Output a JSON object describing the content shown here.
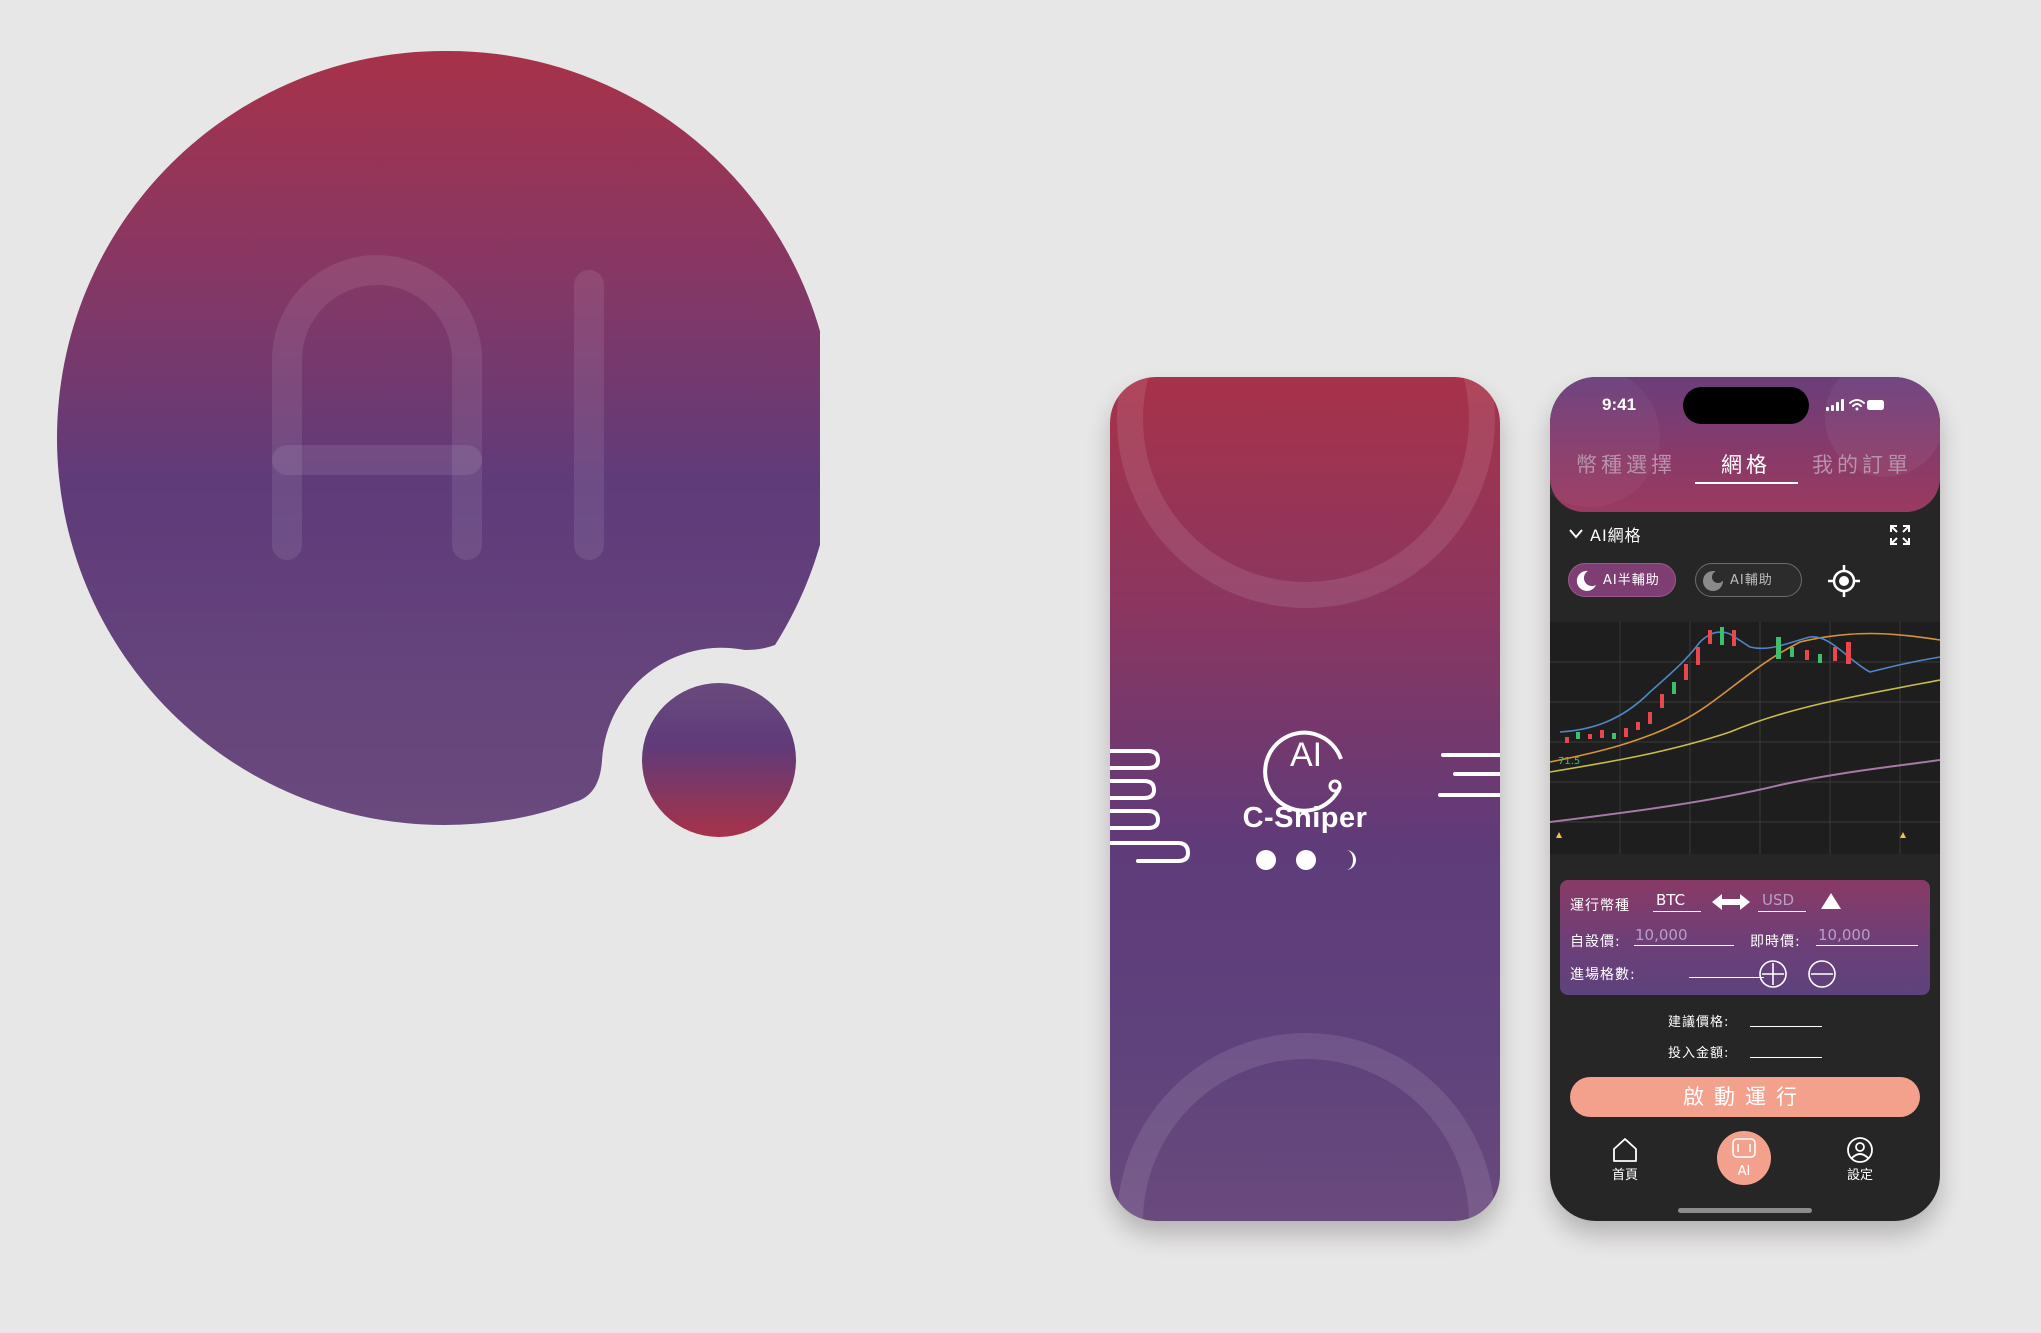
{
  "logo": {
    "text": "AI"
  },
  "splash": {
    "logo_text": "AI",
    "app_name": "C-Sniper"
  },
  "status_bar": {
    "time": "9:41"
  },
  "tabs": [
    {
      "label": "幣種選擇",
      "active": false
    },
    {
      "label": "網格",
      "active": true
    },
    {
      "label": "我的訂單",
      "active": false
    }
  ],
  "section": {
    "title": "AI網格"
  },
  "mode_pills": {
    "semi": "AI半輔助",
    "assist": "AI輔助"
  },
  "chart_data": {
    "type": "line",
    "title": "",
    "price_tag": "71.5"
  },
  "params": {
    "pair_label": "運行幣種",
    "base": "BTC",
    "quote": "USD",
    "custom_price_label": "自設價:",
    "custom_price": "10,000",
    "live_price_label": "即時價:",
    "live_price": "10,000",
    "grid_count_label": "進場格數:"
  },
  "suggest": {
    "price_label": "建議價格:",
    "amount_label": "投入金額:"
  },
  "start_button": "啟動運行",
  "bottom_nav": [
    {
      "label": "首頁",
      "icon": "home-icon"
    },
    {
      "label": "AI",
      "icon": "ai-icon"
    },
    {
      "label": "設定",
      "icon": "user-icon"
    }
  ],
  "colors": {
    "brand_red": "#a73249",
    "brand_purple": "#5f3b7a",
    "accent_salmon": "#f3a08c"
  }
}
